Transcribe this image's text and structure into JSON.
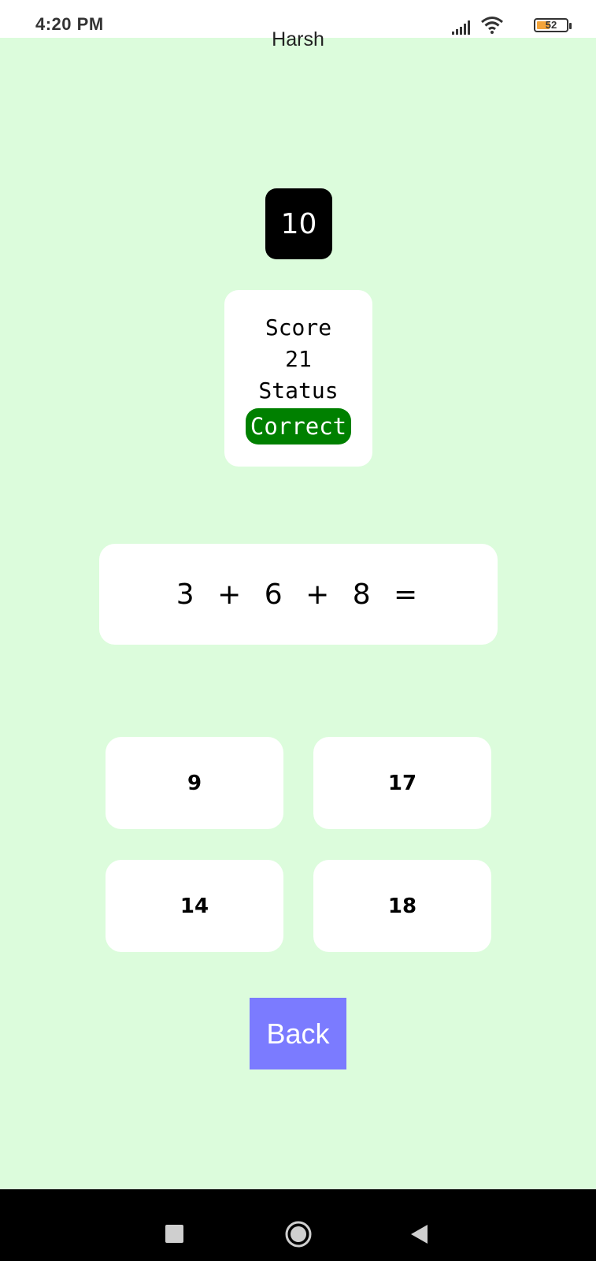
{
  "status_bar": {
    "time": "4:20 PM",
    "battery_level": "52",
    "icons": [
      "signal-icon",
      "wifi-icon",
      "battery-icon"
    ]
  },
  "app": {
    "user_name": "Harsh",
    "timer": "10",
    "score_label": "Score",
    "score_value": "21",
    "status_label": "Status",
    "status_value": "Correct",
    "question": "3 + 6 + 8 =",
    "answers": [
      "9",
      "17",
      "14",
      "18"
    ],
    "back_label": "Back"
  },
  "nav_bar": {
    "icons": [
      "recents-icon",
      "home-icon",
      "back-icon"
    ]
  },
  "colors": {
    "background": "#dcfcdc",
    "timer_bg": "#000000",
    "status_correct": "#008000",
    "back_button": "#7b7bff",
    "card": "#ffffff"
  }
}
